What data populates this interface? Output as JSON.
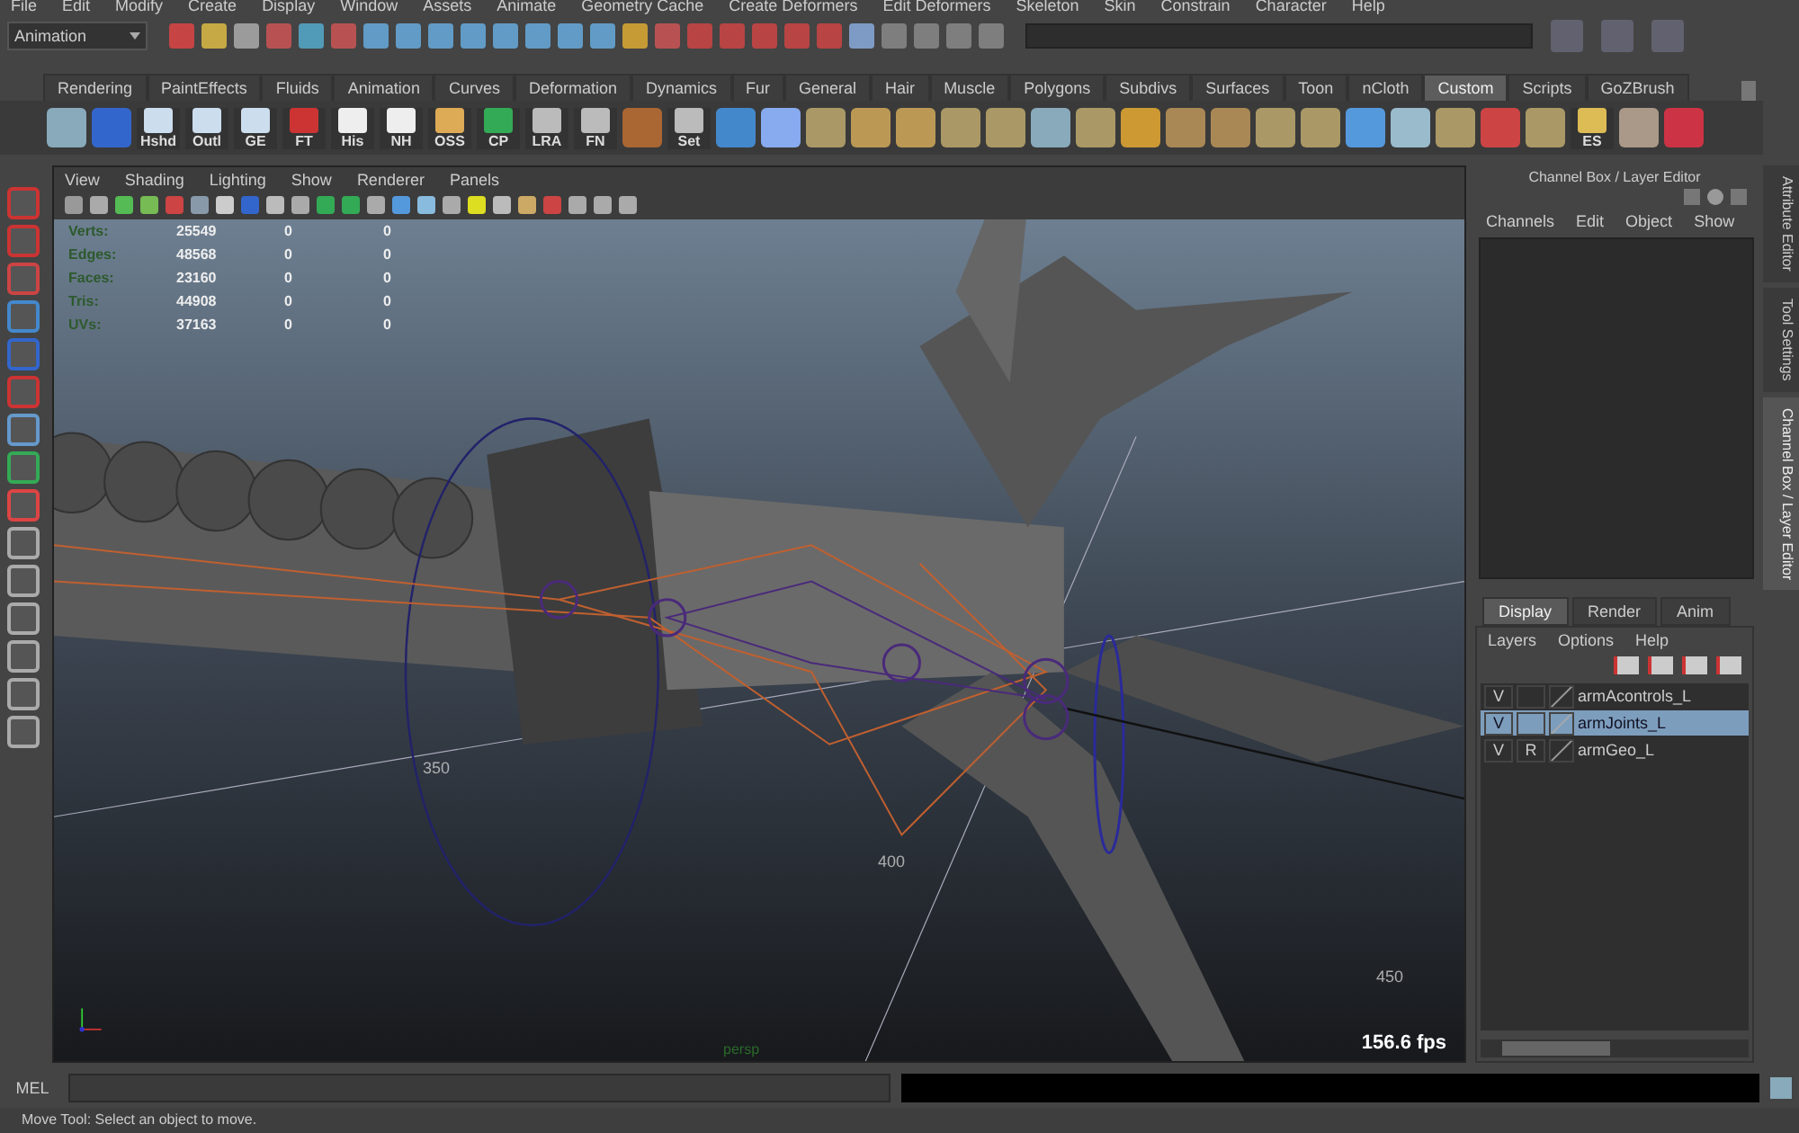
{
  "menu_bar": [
    "File",
    "Edit",
    "Modify",
    "Create",
    "Display",
    "Window",
    "Assets",
    "Animate",
    "Geometry Cache",
    "Create Deformers",
    "Edit Deformers",
    "Skeleton",
    "Skin",
    "Constrain",
    "Character",
    "Help"
  ],
  "mode_selector": {
    "value": "Animation"
  },
  "shelf_tabs": [
    {
      "label": "Rendering",
      "selected": false
    },
    {
      "label": "PaintEffects",
      "selected": false
    },
    {
      "label": "Fluids",
      "selected": false
    },
    {
      "label": "Animation",
      "selected": false
    },
    {
      "label": "Curves",
      "selected": false
    },
    {
      "label": "Deformation",
      "selected": false
    },
    {
      "label": "Dynamics",
      "selected": false
    },
    {
      "label": "Fur",
      "selected": false
    },
    {
      "label": "General",
      "selected": false
    },
    {
      "label": "Hair",
      "selected": false
    },
    {
      "label": "Muscle",
      "selected": false
    },
    {
      "label": "Polygons",
      "selected": false
    },
    {
      "label": "Subdivs",
      "selected": false
    },
    {
      "label": "Surfaces",
      "selected": false
    },
    {
      "label": "Toon",
      "selected": false
    },
    {
      "label": "nCloth",
      "selected": false
    },
    {
      "label": "Custom",
      "selected": true
    },
    {
      "label": "Scripts",
      "selected": false
    },
    {
      "label": "GoZBrush",
      "selected": false
    }
  ],
  "shelf_items": [
    {
      "kind": "icon"
    },
    {
      "kind": "icon"
    },
    {
      "kind": "labeled",
      "label": "Hshd"
    },
    {
      "kind": "labeled",
      "label": "Outl"
    },
    {
      "kind": "labeled",
      "label": "GE"
    },
    {
      "kind": "labeled",
      "label": "FT"
    },
    {
      "kind": "labeled",
      "label": "His"
    },
    {
      "kind": "labeled",
      "label": "NH"
    },
    {
      "kind": "labeled",
      "label": "OSS"
    },
    {
      "kind": "labeled",
      "label": "CP"
    },
    {
      "kind": "labeled",
      "label": "LRA"
    },
    {
      "kind": "labeled",
      "label": "FN"
    },
    {
      "kind": "icon"
    },
    {
      "kind": "labeled",
      "label": "Set"
    },
    {
      "kind": "icon"
    },
    {
      "kind": "icon"
    },
    {
      "kind": "icon"
    },
    {
      "kind": "icon"
    },
    {
      "kind": "icon"
    },
    {
      "kind": "icon"
    },
    {
      "kind": "icon"
    },
    {
      "kind": "icon"
    },
    {
      "kind": "icon"
    },
    {
      "kind": "icon"
    },
    {
      "kind": "icon"
    },
    {
      "kind": "icon"
    },
    {
      "kind": "icon"
    },
    {
      "kind": "icon"
    },
    {
      "kind": "icon"
    },
    {
      "kind": "icon"
    },
    {
      "kind": "icon"
    },
    {
      "kind": "icon"
    },
    {
      "kind": "icon"
    },
    {
      "kind": "labeled",
      "label": "ES"
    },
    {
      "kind": "icon"
    },
    {
      "kind": "icon"
    }
  ],
  "viewport": {
    "menu": [
      "View",
      "Shading",
      "Lighting",
      "Show",
      "Renderer",
      "Panels"
    ],
    "hud": [
      {
        "label": "Verts:",
        "values": [
          "25549",
          "0",
          "0"
        ]
      },
      {
        "label": "Edges:",
        "values": [
          "48568",
          "0",
          "0"
        ]
      },
      {
        "label": "Faces:",
        "values": [
          "23160",
          "0",
          "0"
        ]
      },
      {
        "label": "Tris:",
        "values": [
          "44908",
          "0",
          "0"
        ]
      },
      {
        "label": "UVs:",
        "values": [
          "37163",
          "0",
          "0"
        ]
      }
    ],
    "grid_labels": [
      "350",
      "400",
      "450"
    ],
    "camera": "persp",
    "fps": "156.6 fps"
  },
  "channel_box": {
    "title": "Channel Box / Layer Editor",
    "menu": [
      "Channels",
      "Edit",
      "Object",
      "Show"
    ]
  },
  "layer_editor": {
    "tabs": [
      {
        "label": "Display",
        "selected": true
      },
      {
        "label": "Render",
        "selected": false
      },
      {
        "label": "Anim",
        "selected": false
      }
    ],
    "menu": [
      "Layers",
      "Options",
      "Help"
    ],
    "layers": [
      {
        "name": "armAcontrols_L",
        "visibility": "V",
        "selected": false
      },
      {
        "name": "armJoints_L",
        "visibility": "V",
        "selected": true
      },
      {
        "name": "armGeo_L",
        "visibility": "V",
        "type": "R",
        "selected": false
      }
    ]
  },
  "side_tabs": [
    {
      "label": "Attribute Editor",
      "selected": false
    },
    {
      "label": "Tool Settings",
      "selected": false
    },
    {
      "label": "Channel Box / Layer Editor",
      "selected": true
    }
  ],
  "command_line": {
    "label": "MEL"
  },
  "help_line": "Move Tool: Select an object to move."
}
